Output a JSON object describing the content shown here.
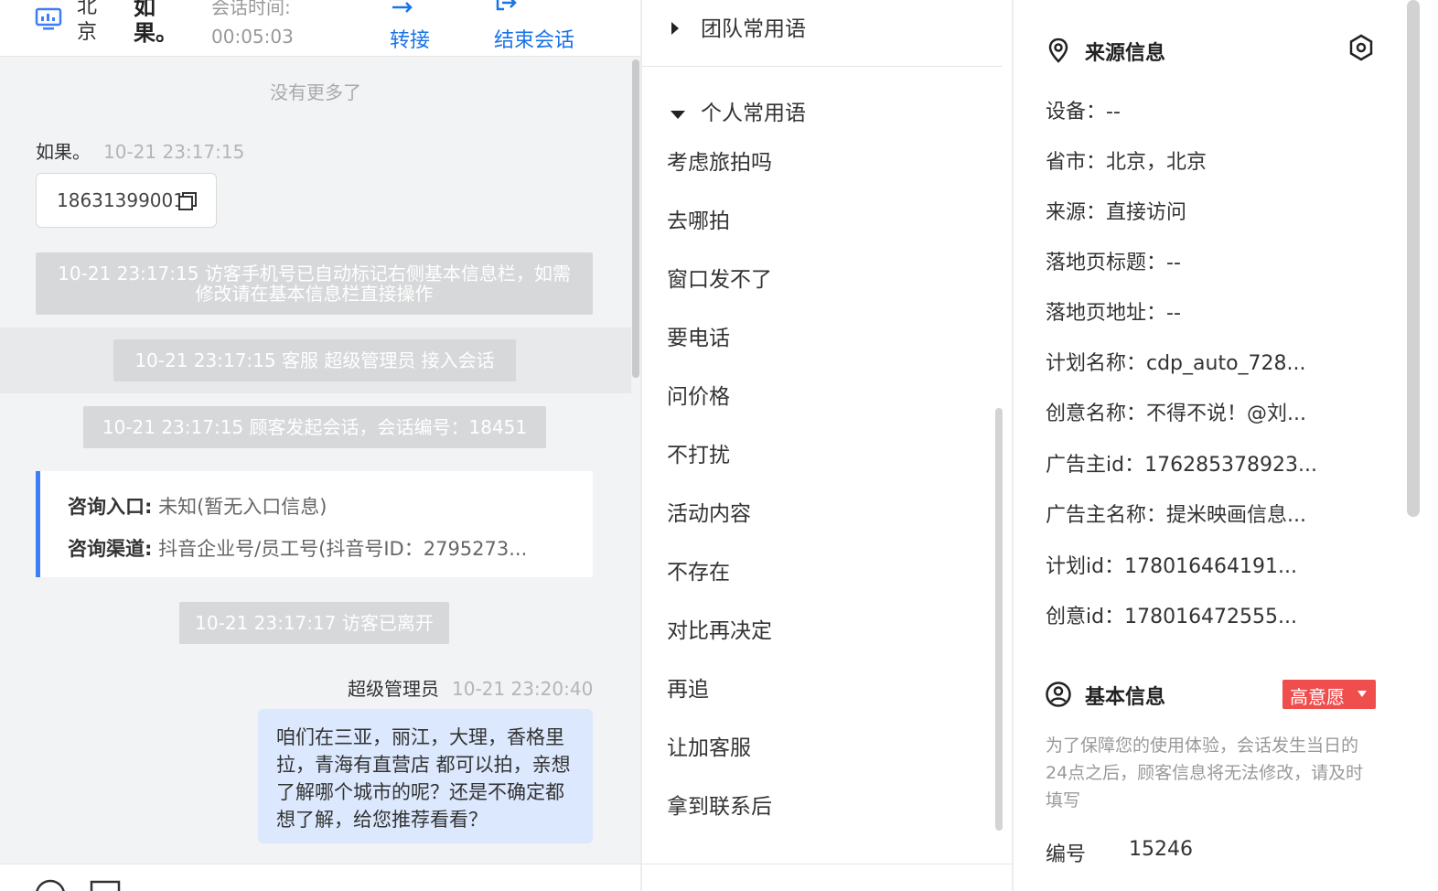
{
  "header": {
    "city": "北京",
    "visitor_name": "如果。",
    "session_time_label": "会话时间:",
    "session_time": "00:05:03",
    "transfer_label": "转接",
    "end_session_label": "结束会话"
  },
  "chat": {
    "no_more": "没有更多了",
    "visitor_msg": {
      "sender": "如果。",
      "time": "10-21 23:17:15",
      "phone": "18631399001"
    },
    "system_messages": [
      "10-21 23:17:15 访客手机号已自动标记右侧基本信息栏，如需修改请在基本信息栏直接操作",
      "10-21 23:17:15 客服 超级管理员 接入会话",
      "10-21 23:17:15 顾客发起会话，会话编号：18451",
      "10-21 23:17:17 访客已离开"
    ],
    "entry_card": {
      "entry_label": "咨询入口:",
      "entry_value": "未知(暂无入口信息)",
      "channel_label": "咨询渠道:",
      "channel_value": "抖音企业号/员工号(抖音号ID：2795273..."
    },
    "agent_msg": {
      "sender": "超级管理员",
      "time": "10-21 23:20:40",
      "text": "咱们在三亚，丽江，大理，香格里拉，青海有直营店 都可以拍，亲想了解哪个城市的呢？还是不确定都想了解，给您推荐看看？"
    }
  },
  "phrases": {
    "team_group": "团队常用语",
    "personal_group": "个人常用语",
    "items": [
      "考虑旅拍吗",
      "去哪拍",
      "窗口发不了",
      "要电话",
      "问价格",
      "不打扰",
      "活动内容",
      "不存在",
      "对比再决定",
      "再追",
      "让加客服",
      "拿到联系后"
    ]
  },
  "source_info": {
    "title": "来源信息",
    "rows": [
      "设备：--",
      "省市：北京，北京",
      "来源：直接访问",
      "落地页标题：--",
      "落地页地址：--",
      "计划名称：cdp_auto_728...",
      "创意名称：不得不说！@刘...",
      "广告主id：176285378923...",
      "广告主名称：提米映画信息...",
      "计划id：178016464191...",
      "创意id：178016472555..."
    ]
  },
  "basic_info": {
    "title": "基本信息",
    "intent_badge": "高意愿",
    "notice": "为了保障您的使用体验，会话发生当日的24点之后，顾客信息将无法修改，请及时填写",
    "number_label": "编号",
    "number_value": "15246"
  },
  "colors": {
    "accent": "#1a73e8",
    "card_border": "#3f7df6",
    "badge": "#f04d4d",
    "bubble": "#dbe8fd"
  }
}
